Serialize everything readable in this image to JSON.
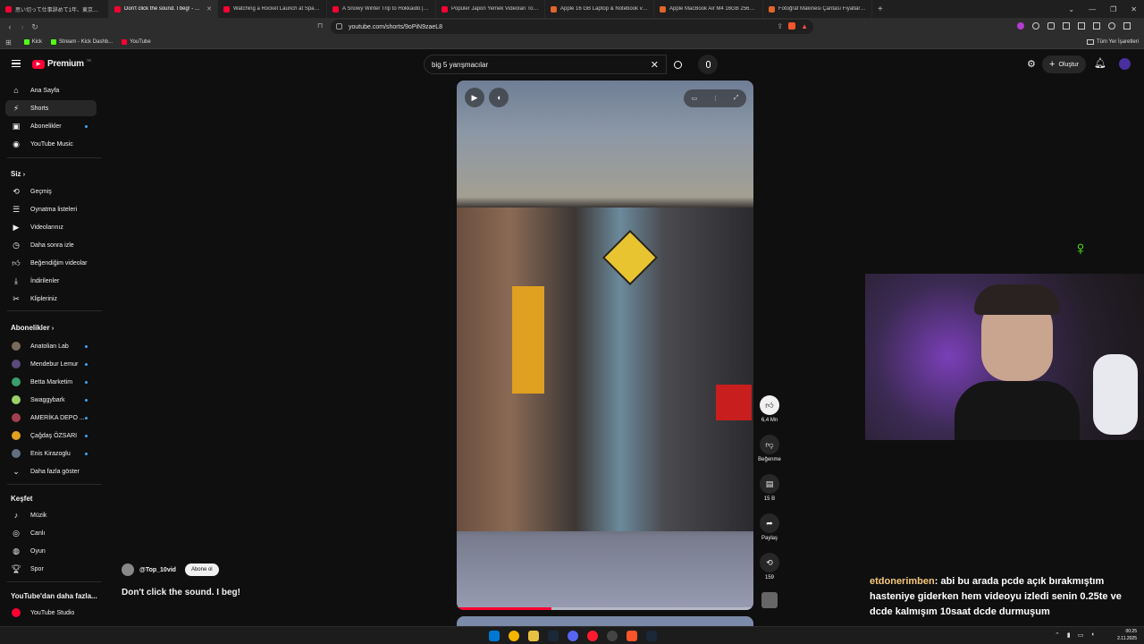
{
  "browser": {
    "tabs": [
      {
        "title": "思い切って仕事辞めて1年、東京で日本語...",
        "fav": "yt"
      },
      {
        "title": "Don't click the sound. I beg! - YouTube",
        "fav": "yt",
        "active": true
      },
      {
        "title": "Watching a Rocket Launch at SpaceX...",
        "fav": "yt"
      },
      {
        "title": "A Snowy Winter Trip to Hokkaido | Y...",
        "fav": "yt"
      },
      {
        "title": "Popüler Japon Yemek Videoları Top Y...",
        "fav": "yt"
      },
      {
        "title": "Apple 16 GB Laptop & Notebook ve...",
        "fav": "ap"
      },
      {
        "title": "Apple MacBook Air M4 16GB 256GB...",
        "fav": "ap"
      },
      {
        "title": "Fotoğraf Makinesi Çantası Fiyatları, E...",
        "fav": "ap"
      }
    ],
    "url": "youtube.com/shorts/9oPiN9zaeL8",
    "bookmarks": [
      "Kick",
      "Stream - Kick Dashb...",
      "YouTube"
    ],
    "all_bookmarks_label": "Tüm Yer İşaretleri"
  },
  "youtube": {
    "logo_text": "Premium",
    "logo_sup": "TR",
    "search_value": "big 5 yarışmacılar",
    "create_label": "Oluştur",
    "sidebar": {
      "main": [
        "Ana Sayfa",
        "Shorts",
        "Abonelikler",
        "YouTube Music"
      ],
      "siz_title": "Siz",
      "siz": [
        "Geçmiş",
        "Oynatma listeleri",
        "Videolarınız",
        "Daha sonra izle",
        "Beğendiğim videolar",
        "İndirilenler",
        "Klipleriniz"
      ],
      "subs_title": "Abonelikler",
      "subs": [
        "Anatolian Lab",
        "Mendebur Lemur",
        "Betta Marketim",
        "Swaggybark",
        "AMERİKA DEPO ...",
        "Çağdaş ÖZSARI",
        "Enis Kirazoglu"
      ],
      "show_more": "Daha fazla göster",
      "explore_title": "Keşfet",
      "explore": [
        "Müzik",
        "Canlı",
        "Oyun",
        "Spor"
      ],
      "more_title": "YouTube'dan daha fazla...",
      "more": [
        "YouTube Studio"
      ]
    },
    "short": {
      "channel": "@Top_10vid",
      "subscribe_label": "Abone ol",
      "title": "Don't click the sound. I beg!",
      "progress": 0.32
    },
    "actions": {
      "like_count": "6,4 Mn",
      "dislike_label": "Beğenme",
      "comment_count": "15 B",
      "share_label": "Paylaş",
      "remix_count": "159"
    }
  },
  "stream_chat": {
    "user": "etdonerimben",
    "message": ": abi bu arada pcde açık bırakmıştım hasteniye giderken hem videoyu izledi senin 0.25te ve dcde kalmışım 10saat dcde durmuşum"
  },
  "taskbar": {
    "time": "00:25",
    "date": "2.11.2025"
  },
  "colors": {
    "youtube_red": "#ff0033",
    "accent_blue": "#3ea6ff",
    "kick_green": "#53fc18"
  }
}
